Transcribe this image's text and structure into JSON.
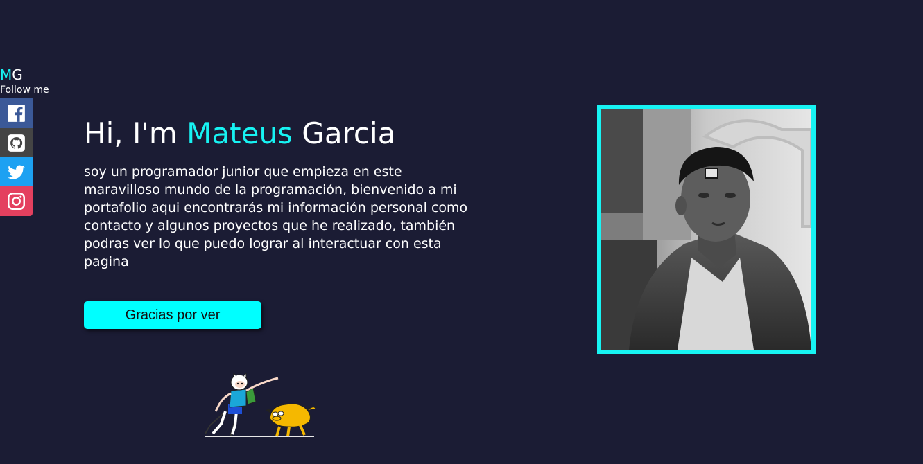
{
  "brand": {
    "logo_first": "M",
    "logo_second": "G",
    "follow_label": "Follow me"
  },
  "social": [
    {
      "name": "facebook",
      "icon": "facebook-icon",
      "color": "#3b5998"
    },
    {
      "name": "github",
      "icon": "github-icon",
      "color": "#444444"
    },
    {
      "name": "twitter",
      "icon": "twitter-icon",
      "color": "#1da1f2"
    },
    {
      "name": "instagram",
      "icon": "instagram-icon",
      "color": "#e4405f"
    }
  ],
  "hero": {
    "greeting": "Hi, I'm ",
    "first_name": "Mateus",
    "last_name": " Garcia",
    "description": "soy un programador junior que empieza en este maravilloso mundo de la programación, bienvenido a mi portafolio aqui encontrarás mi información personal como contacto y algunos proyectos que he realizado, también podras ver lo que puedo lograr al interactuar con esta pagina",
    "button_label": "Gracias por ver"
  },
  "colors": {
    "background": "#1b1c34",
    "accent": "#17f3f3",
    "button": "#00ffff",
    "text": "#ffffff"
  }
}
